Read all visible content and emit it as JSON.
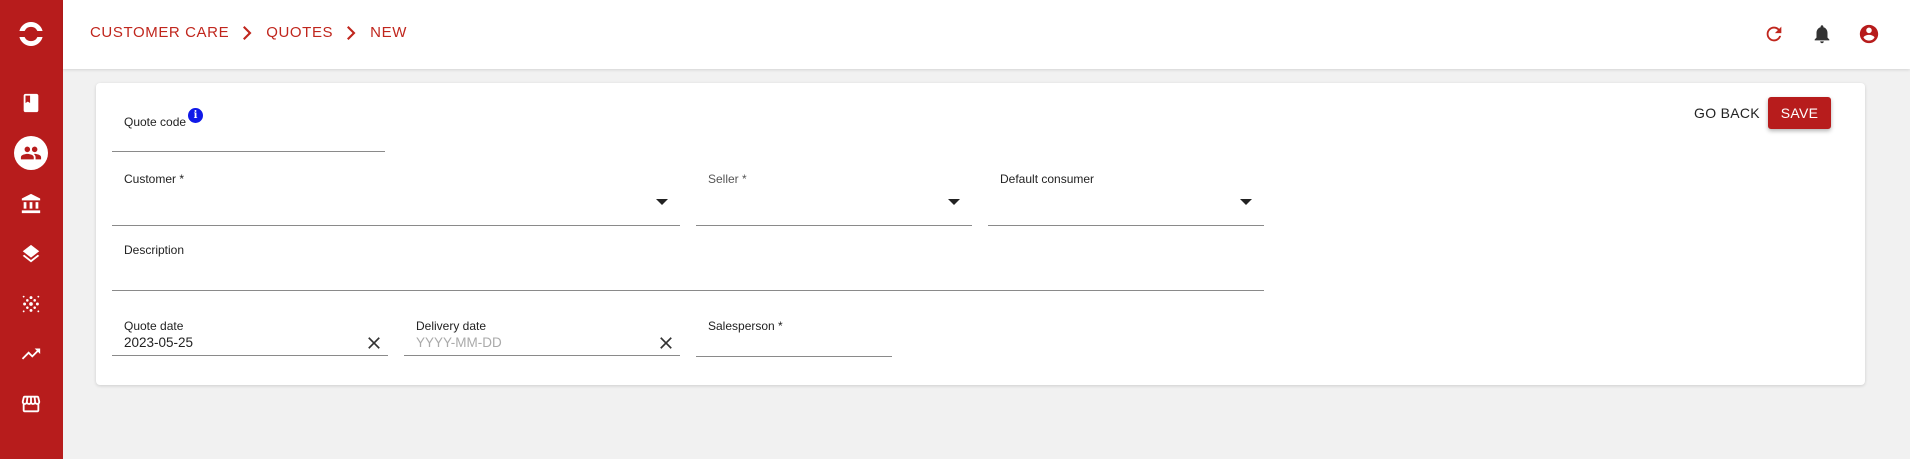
{
  "breadcrumb": [
    "CUSTOMER CARE",
    "QUOTES",
    "NEW"
  ],
  "sidebar": {
    "logo": "app-logo-icon",
    "items": [
      {
        "icon": "book-icon"
      },
      {
        "icon": "people-icon",
        "active": true
      },
      {
        "icon": "bank-icon"
      },
      {
        "icon": "layers-icon"
      },
      {
        "icon": "dots-grid-icon"
      },
      {
        "icon": "trending-up-icon"
      },
      {
        "icon": "store-icon"
      }
    ]
  },
  "topbar": {
    "icons": [
      "refresh-icon",
      "bell-icon",
      "account-icon"
    ],
    "accent": "#c0261d"
  },
  "actions": {
    "back_label": "GO BACK",
    "save_label": "SAVE"
  },
  "form": {
    "quote_code": {
      "label": "Quote code",
      "value": ""
    },
    "customer": {
      "label": "Customer *",
      "value": ""
    },
    "seller": {
      "label": "Seller *",
      "value": ""
    },
    "default_consumer": {
      "label": "Default consumer",
      "value": ""
    },
    "description": {
      "label": "Description",
      "value": ""
    },
    "quote_date": {
      "label": "Quote date",
      "value": "2023-05-25"
    },
    "delivery_date": {
      "label": "Delivery date",
      "placeholder": "YYYY-MM-DD",
      "value": ""
    },
    "salesperson": {
      "label": "Salesperson *",
      "value": ""
    }
  },
  "colors": {
    "brand": "#b71c1c",
    "info": "#1019e8"
  }
}
